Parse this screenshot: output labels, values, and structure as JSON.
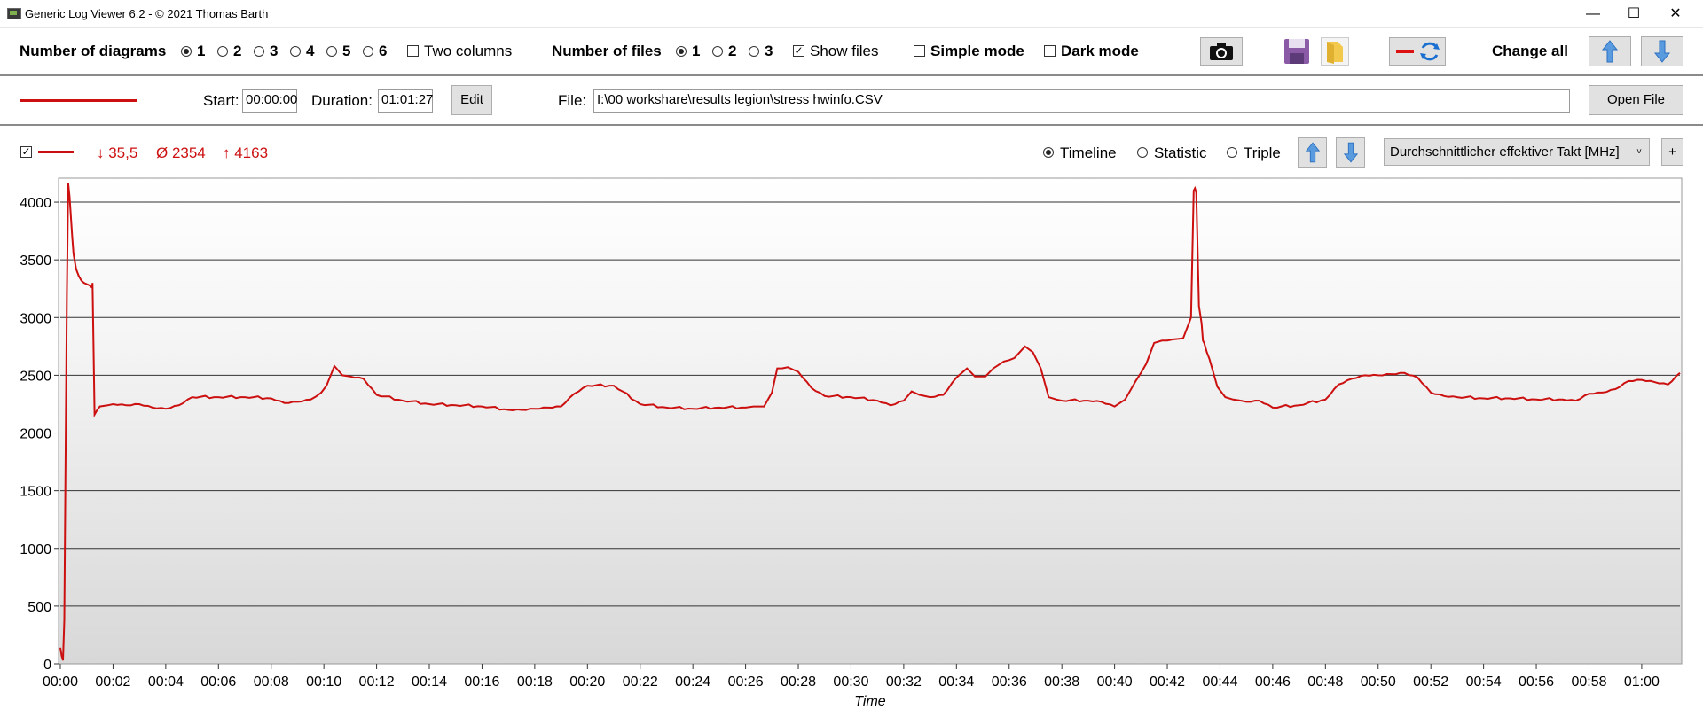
{
  "window": {
    "title": "Generic Log Viewer 6.2 - © 2021 Thomas Barth",
    "minimize": "—",
    "maximize": "☐",
    "close": "✕"
  },
  "toolbar": {
    "diagrams_label": "Number of diagrams",
    "diagram_options": [
      "1",
      "2",
      "3",
      "4",
      "5",
      "6"
    ],
    "diagrams_selected": "1",
    "two_columns_label": "Two columns",
    "files_label": "Number of files",
    "file_options": [
      "1",
      "2",
      "3"
    ],
    "files_selected": "1",
    "show_files_label": "Show files",
    "show_files_checked": true,
    "simple_mode_label": "Simple mode",
    "dark_mode_label": "Dark mode",
    "change_all_label": "Change all"
  },
  "file_row": {
    "start_label": "Start:",
    "start_value": "00:00:00",
    "duration_label": "Duration:",
    "duration_value": "01:01:27",
    "edit_label": "Edit",
    "file_label": "File:",
    "file_path": "I:\\00 workshare\\results legion\\stress hwinfo.CSV",
    "open_file_label": "Open File",
    "line_color": "#cc1010"
  },
  "chart_controls": {
    "min_label": "↓ 35,5",
    "avg_label": "Ø 2354",
    "max_label": "↑ 4163",
    "views": [
      "Timeline",
      "Statistic",
      "Triple"
    ],
    "view_selected": "Timeline",
    "sensor_select": "Durchschnittlicher effektiver Takt [MHz]",
    "add_label": "+"
  },
  "chart_data": {
    "type": "line",
    "xlabel": "Time",
    "ylabel": "",
    "ylim": [
      0,
      4200
    ],
    "xlim_minutes": [
      0,
      61.45
    ],
    "y_ticks": [
      0,
      500,
      1000,
      1500,
      2000,
      2500,
      3000,
      3500,
      4000
    ],
    "x_tick_labels": [
      "00:00",
      "00:02",
      "00:04",
      "00:06",
      "00:08",
      "00:10",
      "00:12",
      "00:14",
      "00:16",
      "00:18",
      "00:20",
      "00:22",
      "00:24",
      "00:26",
      "00:28",
      "00:30",
      "00:32",
      "00:34",
      "00:36",
      "00:38",
      "00:40",
      "00:42",
      "00:44",
      "00:46",
      "00:48",
      "00:50",
      "00:52",
      "00:54",
      "00:56",
      "00:58",
      "01:00"
    ],
    "grid": true,
    "series": [
      {
        "color": "#cc1010",
        "x_minutes": [
          0.0,
          0.05,
          0.1,
          0.15,
          0.2,
          0.25,
          0.3,
          0.35,
          0.45,
          0.5,
          0.6,
          0.7,
          0.8,
          0.9,
          1.0,
          1.1,
          1.2,
          1.22,
          1.3,
          1.35,
          1.4,
          1.5,
          1.8,
          2,
          2.5,
          3,
          3.5,
          4,
          4.5,
          5,
          6,
          7,
          8,
          8.5,
          9,
          9.5,
          9.9,
          10.1,
          10.4,
          10.7,
          11,
          11.5,
          12,
          13,
          14,
          15,
          16,
          17,
          17.5,
          18,
          18.5,
          19,
          19.5,
          20,
          21,
          22,
          23,
          24,
          25,
          26,
          26.3,
          26.7,
          27,
          27.2,
          27.6,
          28,
          28.5,
          29,
          30,
          31,
          31.5,
          32,
          32.3,
          32.6,
          33,
          33.5,
          34,
          34.4,
          34.7,
          35.1,
          35.4,
          35.8,
          36.2,
          36.6,
          36.9,
          37.2,
          37.5,
          37.8,
          38,
          39,
          39.5,
          40,
          40.4,
          40.8,
          41.2,
          41.5,
          41.8,
          42.2,
          42.6,
          42.9,
          43.0,
          43.05,
          43.1,
          43.2,
          43.3,
          43.35,
          43.4,
          43.5,
          43.6,
          43.9,
          44.2,
          44.5,
          44.8,
          45,
          45.5,
          46,
          47,
          48,
          48.5,
          49,
          49.5,
          50,
          50.5,
          51,
          51.5,
          52,
          52.5,
          53,
          54,
          55,
          56,
          57,
          57.5,
          58,
          58.5,
          59,
          59.5,
          60,
          60.5,
          61,
          61.45
        ],
        "y_mhz": [
          140,
          70,
          30,
          380,
          1750,
          3200,
          4163,
          4050,
          3700,
          3550,
          3420,
          3360,
          3320,
          3300,
          3290,
          3280,
          3260,
          3300,
          2160,
          2180,
          2200,
          2230,
          2240,
          2250,
          2240,
          2250,
          2220,
          2210,
          2240,
          2310,
          2310,
          2310,
          2300,
          2260,
          2270,
          2290,
          2350,
          2410,
          2580,
          2500,
          2490,
          2470,
          2330,
          2280,
          2250,
          2240,
          2230,
          2200,
          2200,
          2210,
          2220,
          2230,
          2340,
          2410,
          2410,
          2250,
          2220,
          2210,
          2220,
          2220,
          2230,
          2230,
          2350,
          2560,
          2570,
          2530,
          2390,
          2320,
          2310,
          2280,
          2240,
          2280,
          2360,
          2330,
          2310,
          2330,
          2480,
          2560,
          2490,
          2490,
          2560,
          2620,
          2650,
          2750,
          2700,
          2560,
          2310,
          2290,
          2280,
          2280,
          2270,
          2230,
          2290,
          2450,
          2600,
          2780,
          2800,
          2810,
          2820,
          3000,
          4100,
          4120,
          4080,
          3100,
          2950,
          2800,
          2780,
          2700,
          2640,
          2400,
          2310,
          2290,
          2280,
          2270,
          2280,
          2220,
          2240,
          2290,
          2420,
          2470,
          2500,
          2500,
          2510,
          2520,
          2480,
          2350,
          2320,
          2310,
          2300,
          2300,
          2290,
          2290,
          2280,
          2340,
          2350,
          2380,
          2450,
          2460,
          2440,
          2420,
          2520
        ]
      }
    ]
  }
}
